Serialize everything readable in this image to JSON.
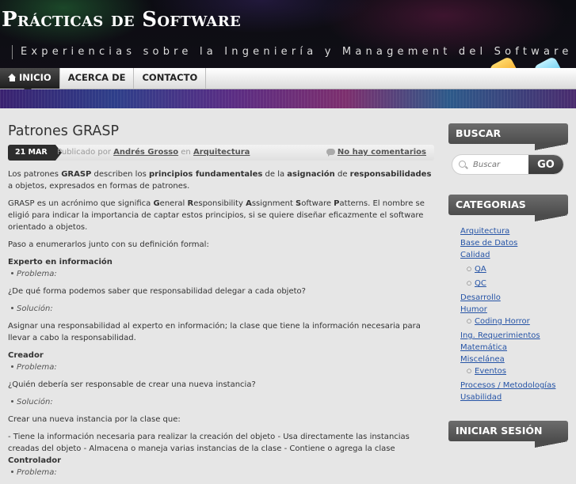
{
  "site": {
    "title": "Prácticas de Software",
    "tagline": "Experiencias sobre la Ingeniería y Management del Software"
  },
  "nav": {
    "items": [
      "INICIO",
      "ACERCA DE",
      "CONTACTO"
    ],
    "active": 0
  },
  "post": {
    "title": "Patrones GRASP",
    "date": "21 MAR",
    "by_prefix": "Publicado por",
    "author": "Andrés Grosso",
    "in_word": "en",
    "category": "Arquitectura",
    "comments": "No hay comentarios",
    "intro": {
      "t1": "Los patrones ",
      "b1": "GRASP",
      "t2": " describen los ",
      "b2": "principios fundamentales",
      "t3": " de la ",
      "b3": "asignación",
      "t4": " de ",
      "b4": "responsabilidades",
      "t5": " a objetos, expresados en formas de patrones."
    },
    "acronym": {
      "t1": "GRASP es un acrónimo que significa ",
      "words": [
        {
          "cap": "G",
          "rest": "eneral "
        },
        {
          "cap": "R",
          "rest": "esponsibility "
        },
        {
          "cap": "A",
          "rest": "ssignment "
        },
        {
          "cap": "S",
          "rest": "oftware "
        },
        {
          "cap": "P",
          "rest": "atterns"
        }
      ],
      "t2": ". El nombre se eligió para indicar la importancia de captar estos principios, si se quiere diseñar eficazmente el software orientado a objetos."
    },
    "list_intro": "Paso a enumerarlos junto con su definición formal:",
    "problem_label": "Problema:",
    "solution_label": "Solución:",
    "patterns": [
      {
        "name": "Experto en información",
        "problem": "¿De qué forma podemos saber que responsabilidad delegar a cada objeto?",
        "solution": "Asignar una responsabilidad al experto en información; la clase que tiene la información necesaria para llevar a cabo la responsabilidad."
      },
      {
        "name": "Creador",
        "problem": "¿Quién debería ser responsable de crear una nueva instancia?",
        "solution": "Crear una nueva instancia por la clase que:",
        "details": "- Tiene la información necesaria para realizar la creación del objeto - Usa directamente las instancias creadas del objeto - Almacena o maneja varias instancias de la clase - Contiene o agrega la clase ",
        "details_bold": "Controlador"
      }
    ],
    "trailing_problem": "Problema:"
  },
  "sidebar": {
    "search": {
      "title": "BUSCAR",
      "placeholder": "Buscar",
      "button": "GO"
    },
    "categories": {
      "title": "CATEGORIAS",
      "items": [
        {
          "label": "Arquitectura",
          "level": 0
        },
        {
          "label": "Base de Datos",
          "level": 0
        },
        {
          "label": "Calidad",
          "level": 0
        },
        {
          "label": "QA",
          "level": 1
        },
        {
          "label": "QC",
          "level": 1
        },
        {
          "label": "Desarrollo",
          "level": 0
        },
        {
          "label": "Humor",
          "level": 0
        },
        {
          "label": "Coding Horror",
          "level": 1
        },
        {
          "label": "Ing. Requerimientos",
          "level": 0
        },
        {
          "label": "Matemática",
          "level": 0
        },
        {
          "label": "Miscelánea",
          "level": 0
        },
        {
          "label": "Eventos",
          "level": 1
        },
        {
          "label": "Procesos / Metodologías",
          "level": 0
        },
        {
          "label": "Usabilidad",
          "level": 0
        }
      ]
    },
    "login": {
      "title": "INICIAR SESIÓN"
    }
  },
  "colors": {
    "link": "#2654a6",
    "widget_bg": "#555555",
    "nav_active": "#2d2d2d"
  }
}
